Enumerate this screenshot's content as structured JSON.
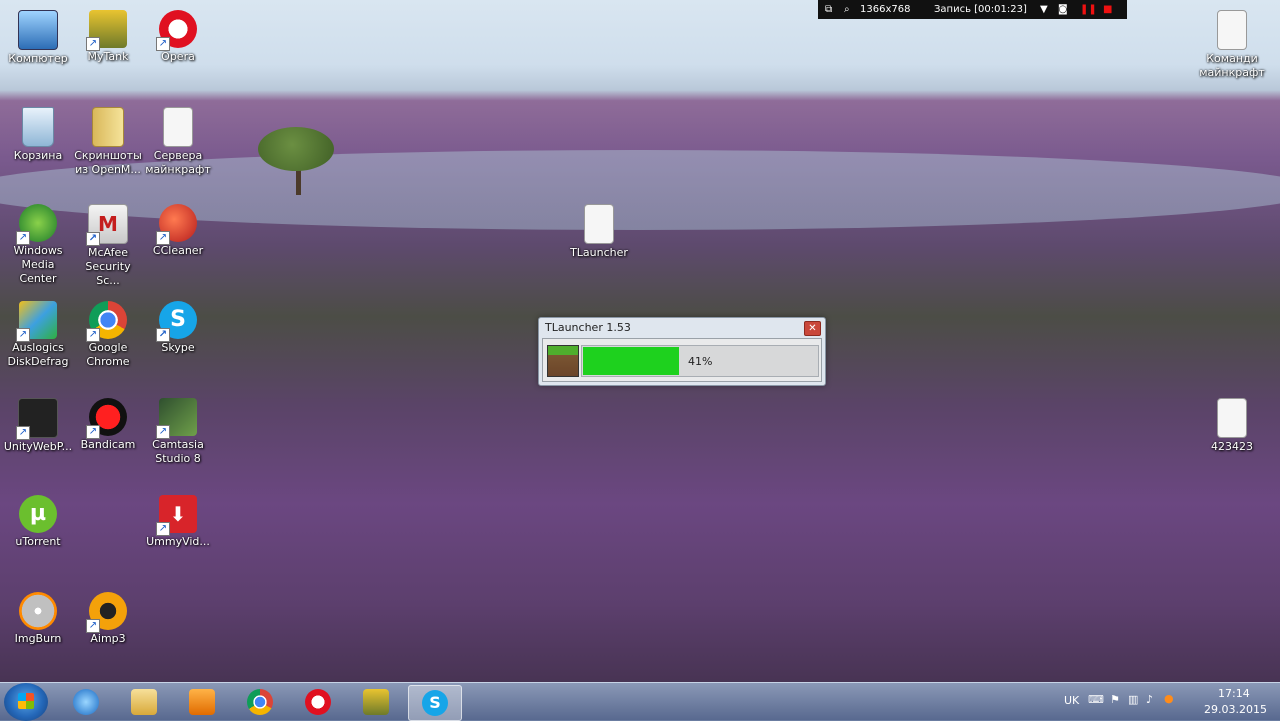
{
  "recorder": {
    "resolution": "1366x768",
    "status": "Запись [00:01:23]"
  },
  "desktop_icons": [
    {
      "label": "Компютер",
      "icon": "computer-icon",
      "shortcut": false
    },
    {
      "label": "MyTank",
      "icon": "tank-game-icon",
      "shortcut": true
    },
    {
      "label": "Opera",
      "icon": "opera-icon",
      "shortcut": true
    },
    {
      "label": "Корзина",
      "icon": "recycle-bin-icon",
      "shortcut": false
    },
    {
      "label": "Скриншоты\nиз OpenM...",
      "icon": "folder-icon",
      "shortcut": false
    },
    {
      "label": "Сервера\nмайнкрафт",
      "icon": "text-file-icon",
      "shortcut": false
    },
    {
      "label": "Windows\nMedia Center",
      "icon": "windows-media-center-icon",
      "shortcut": true
    },
    {
      "label": "McAfee\nSecurity Sc...",
      "icon": "mcafee-icon",
      "shortcut": true
    },
    {
      "label": "CCleaner",
      "icon": "ccleaner-icon",
      "shortcut": true
    },
    {
      "label": "TLauncher",
      "icon": "java-file-icon",
      "shortcut": false
    },
    {
      "label": "Auslogics\nDiskDefrag",
      "icon": "auslogics-icon",
      "shortcut": true
    },
    {
      "label": "Google\nChrome",
      "icon": "chrome-icon",
      "shortcut": true
    },
    {
      "label": "Skype",
      "icon": "skype-icon",
      "shortcut": true
    },
    {
      "label": "UnityWebP...",
      "icon": "unity-icon",
      "shortcut": true
    },
    {
      "label": "Bandicam",
      "icon": "bandicam-icon",
      "shortcut": true
    },
    {
      "label": "Camtasia\nStudio 8",
      "icon": "camtasia-icon",
      "shortcut": true
    },
    {
      "label": "uTorrent",
      "icon": "utorrent-icon",
      "shortcut": false
    },
    {
      "label": "UmmyVid...",
      "icon": "ummy-video-icon",
      "shortcut": true
    },
    {
      "label": "ImgBurn",
      "icon": "imgburn-icon",
      "shortcut": false
    },
    {
      "label": "Aimp3",
      "icon": "aimp-icon",
      "shortcut": true
    },
    {
      "label": "Команди\nмайнкрафт",
      "icon": "text-file-icon",
      "shortcut": false
    },
    {
      "label": "423423",
      "icon": "text-file-icon",
      "shortcut": false
    }
  ],
  "tlauncher": {
    "title": "TLauncher 1.53",
    "progress_percent": 41,
    "progress_label": "41%"
  },
  "taskbar": {
    "pinned": [
      "internet-explorer-icon",
      "explorer-folder-icon",
      "media-player-icon",
      "chrome-icon",
      "opera-icon",
      "tank-game-icon",
      "skype-icon"
    ],
    "active": "skype-icon",
    "language": "UK",
    "time": "17:14",
    "date": "29.03.2015"
  },
  "colors": {
    "progress_fill": "#1ed11e",
    "close_button": "#c9473a"
  }
}
